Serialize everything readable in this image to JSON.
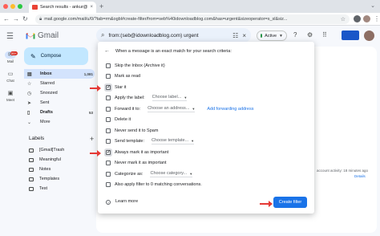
{
  "browser": {
    "tab_title": "Search results - ankur@idow...",
    "tab_close": "×",
    "new_tab": "+",
    "url": "mail.google.com/mail/u/0/?tab=rm&ogbl#create-filter/from=seb%40idownloadblog.com&has=urgent&sizeoperator=s_sl&siz..."
  },
  "gmail": {
    "logo_word": "Gmail",
    "rail": [
      {
        "label": "Mail",
        "badge": "99+"
      },
      {
        "label": "Chat"
      },
      {
        "label": "Meet"
      }
    ],
    "compose_label": "Compose",
    "folders": [
      {
        "label": "Inbox",
        "count": "1,081",
        "bold": true,
        "active": true
      },
      {
        "label": "Starred"
      },
      {
        "label": "Snoozed"
      },
      {
        "label": "Sent"
      },
      {
        "label": "Drafts",
        "count": "53",
        "bold": true
      },
      {
        "label": "More"
      }
    ],
    "labels_heading": "Labels",
    "labels": [
      "[Gmail]Trash",
      "Meaningful",
      "Notes",
      "Templates",
      "Test"
    ],
    "search_query": "from:(seb@idownloadblog.com) urgent",
    "status_label": "Active",
    "account_activity": "account activity: 18 minutes ago",
    "details_link": "Details"
  },
  "filter_dialog": {
    "header": "When a message is an exact match for your search criteria:",
    "options": [
      {
        "label": "Skip the Inbox (Archive it)",
        "checked": false
      },
      {
        "label": "Mark as read",
        "checked": false
      },
      {
        "label": "Star it",
        "checked": true
      },
      {
        "label": "Apply the label:",
        "checked": false,
        "dropdown": "Choose label..."
      },
      {
        "label": "Forward it to:",
        "checked": false,
        "dropdown": "Choose an address...",
        "link": "Add forwarding address"
      },
      {
        "label": "Delete it",
        "checked": false
      },
      {
        "label": "Never send it to Spam",
        "checked": false
      },
      {
        "label": "Send template:",
        "checked": false,
        "dropdown": "Choose template..."
      },
      {
        "label": "Always mark it as important",
        "checked": true
      },
      {
        "label": "Never mark it as important",
        "checked": false
      },
      {
        "label": "Categorize as:",
        "checked": false,
        "dropdown": "Choose category..."
      },
      {
        "label": "Also apply filter to 0 matching conversations.",
        "checked": false
      }
    ],
    "learn_more": "Learn more",
    "create_button": "Create filter"
  },
  "colors": {
    "accent": "#1a73e8",
    "compose_bg": "#c2e7ff",
    "arrow": "#e53935",
    "active_dot": "#1e8e3e"
  }
}
